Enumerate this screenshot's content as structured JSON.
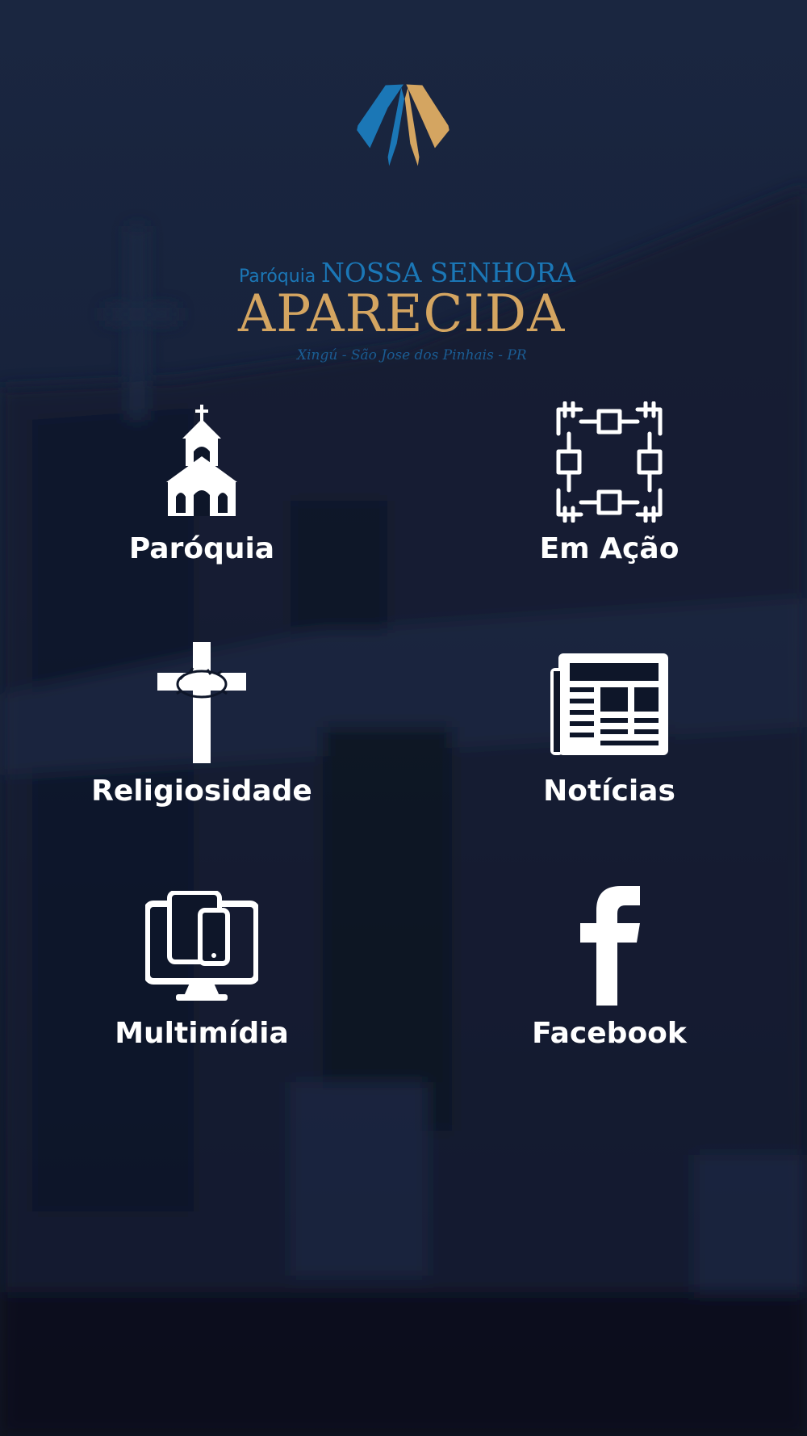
{
  "logo": {
    "prefix": "Paróquia",
    "name": "NOSSA SENHORA",
    "title": "APARECIDA",
    "location": "Xingú - São Jose dos Pinhais - PR"
  },
  "menu": {
    "items": [
      {
        "label": "Paróquia",
        "icon": "church-icon"
      },
      {
        "label": "Em Ação",
        "icon": "joined-hands-icon"
      },
      {
        "label": "Religiosidade",
        "icon": "cross-icon"
      },
      {
        "label": "Notícias",
        "icon": "newspaper-icon"
      },
      {
        "label": "Multimídia",
        "icon": "devices-icon"
      },
      {
        "label": "Facebook",
        "icon": "facebook-icon"
      }
    ]
  },
  "colors": {
    "background": "#0e1629",
    "logo_blue": "#1b77b6",
    "logo_gold": "#d4a561",
    "text": "#ffffff"
  }
}
